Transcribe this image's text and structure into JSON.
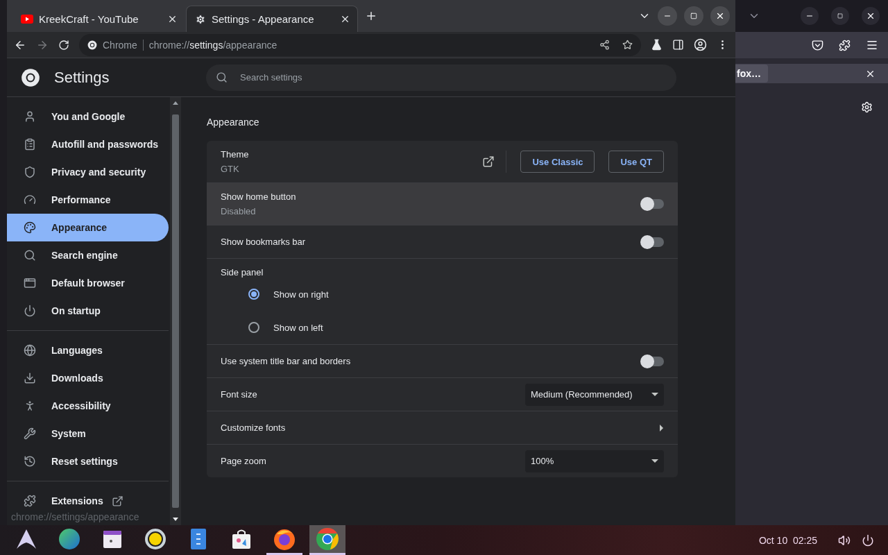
{
  "browser_tabs": [
    {
      "title": "KreekCraft - YouTube",
      "kind": "youtube",
      "selected": false
    },
    {
      "title": "Settings - Appearance",
      "kind": "settings",
      "selected": true
    }
  ],
  "address_bar": {
    "origin": "Chrome",
    "scheme": "chrome://",
    "host": "settings",
    "path": "/appearance"
  },
  "settings_title": "Settings",
  "search": {
    "placeholder": "Search settings"
  },
  "sidebar": {
    "groups": [
      [
        {
          "label": "You and Google",
          "selected": false
        },
        {
          "label": "Autofill and passwords",
          "selected": false
        },
        {
          "label": "Privacy and security",
          "selected": false
        },
        {
          "label": "Performance",
          "selected": false
        },
        {
          "label": "Appearance",
          "selected": true
        },
        {
          "label": "Search engine",
          "selected": false
        },
        {
          "label": "Default browser",
          "selected": false
        },
        {
          "label": "On startup",
          "selected": false
        }
      ],
      [
        {
          "label": "Languages",
          "selected": false
        },
        {
          "label": "Downloads",
          "selected": false
        },
        {
          "label": "Accessibility",
          "selected": false
        },
        {
          "label": "System",
          "selected": false
        },
        {
          "label": "Reset settings",
          "selected": false
        }
      ],
      [
        {
          "label": "Extensions",
          "selected": false,
          "external": true
        }
      ]
    ]
  },
  "section_title": "Appearance",
  "rows": [
    {
      "kind": "theme",
      "label": "Theme",
      "sublabel": "GTK",
      "buttons": [
        "Use Classic",
        "Use QT"
      ],
      "hovered": false
    },
    {
      "kind": "toggle",
      "label": "Show home button",
      "sublabel": "Disabled",
      "on": false,
      "hovered": true
    },
    {
      "kind": "toggle",
      "label": "Show bookmarks bar",
      "on": false,
      "hovered": false
    },
    {
      "kind": "radios",
      "label": "Side panel",
      "hovered": false,
      "options": [
        {
          "label": "Show on right",
          "selected": true
        },
        {
          "label": "Show on left",
          "selected": false
        }
      ]
    },
    {
      "kind": "toggle",
      "label": "Use system title bar and borders",
      "on": false,
      "hovered": false
    },
    {
      "kind": "select",
      "label": "Font size",
      "value": "Medium (Recommended)",
      "hovered": false
    },
    {
      "kind": "link",
      "label": "Customize fonts",
      "hovered": false
    },
    {
      "kind": "select",
      "label": "Page zoom",
      "value": "100%",
      "hovered": false
    }
  ],
  "status_url": "chrome://settings/appearance",
  "background_window": {
    "notification_button": "fox…"
  },
  "taskbar": {
    "apps": [
      {
        "kind": "arch",
        "running": false,
        "selected": false
      },
      {
        "kind": "globe",
        "running": false,
        "selected": false
      },
      {
        "kind": "calendar",
        "running": false,
        "selected": false
      },
      {
        "kind": "speaker",
        "running": false,
        "selected": false
      },
      {
        "kind": "files",
        "running": false,
        "selected": false
      },
      {
        "kind": "store",
        "running": false,
        "selected": false
      },
      {
        "kind": "firefox",
        "running": true,
        "selected": false
      },
      {
        "kind": "chrome",
        "running": true,
        "selected": true
      }
    ],
    "date": "Oct 10",
    "time": "02:25"
  }
}
